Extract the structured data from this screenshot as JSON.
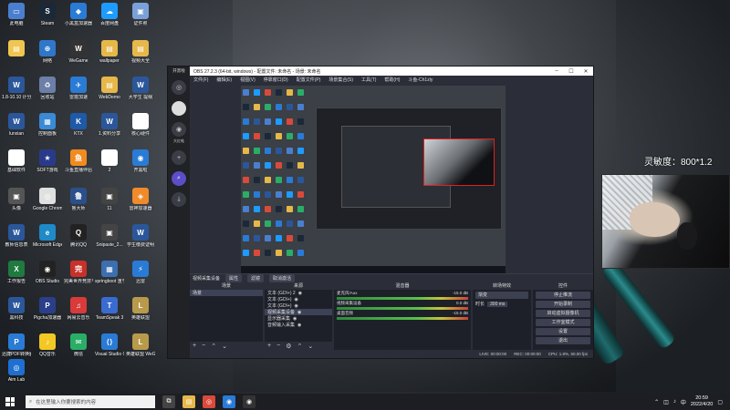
{
  "desktop": {
    "icons": [
      {
        "label": "此电脑",
        "color": "#4a7fd0",
        "glyph": "▭"
      },
      {
        "label": "Steam",
        "color": "#1b2838",
        "glyph": "S"
      },
      {
        "label": "小黑盒加速器",
        "color": "#2a7bd5",
        "glyph": "◆"
      },
      {
        "label": "百度网盘",
        "color": "#1e9bff",
        "glyph": "☁"
      },
      {
        "label": "证件照",
        "color": "#7aa0d8",
        "glyph": "▣"
      },
      {
        "label": "",
        "color": "#f0c650",
        "glyph": "▤"
      },
      {
        "label": "网络",
        "color": "#2f77c9",
        "glyph": "⊕"
      },
      {
        "label": "WeGame",
        "color": "#333333",
        "glyph": "W"
      },
      {
        "label": "wallpaper",
        "color": "#e6b84a",
        "glyph": "▤"
      },
      {
        "label": "视频大全",
        "color": "#e6b84a",
        "glyph": "▤"
      },
      {
        "label": "1.8-10.10 计分比例",
        "color": "#2b579a",
        "glyph": "W"
      },
      {
        "label": "回收站",
        "color": "#6b7fa8",
        "glyph": "♻"
      },
      {
        "label": "雷霆加速",
        "color": "#2a7bd5",
        "glyph": "✈"
      },
      {
        "label": "WebDemo",
        "color": "#e6b84a",
        "glyph": "▤"
      },
      {
        "label": "大学生 提纲",
        "color": "#2b579a",
        "glyph": "W"
      },
      {
        "label": "lunxian",
        "color": "#2b579a",
        "glyph": "W"
      },
      {
        "label": "控制面板",
        "color": "#3a8ad6",
        "glyph": "▦"
      },
      {
        "label": "KTX",
        "color": "#1e5aa8",
        "glyph": "K"
      },
      {
        "label": "1.资料分享",
        "color": "#2b579a",
        "glyph": "W"
      },
      {
        "label": "核心硬件",
        "color": "#ffffff",
        "glyph": "▭"
      },
      {
        "label": "基础软件",
        "color": "#ffffff",
        "glyph": "▭"
      },
      {
        "label": "SOFT游戏",
        "color": "#2a3a8a",
        "glyph": "★"
      },
      {
        "label": "斗鱼直播伴侣",
        "color": "#f28b1e",
        "glyph": "鱼"
      },
      {
        "label": "2",
        "color": "#ffffff",
        "glyph": "▭"
      },
      {
        "label": "开黑啦",
        "color": "#2a7bd5",
        "glyph": "◉"
      },
      {
        "label": "头像",
        "color": "#555555",
        "glyph": "▣"
      },
      {
        "label": "Google Chrome",
        "color": "#e0e0e0",
        "glyph": "◎"
      },
      {
        "label": "鲁大师",
        "color": "#2b4f8a",
        "glyph": "鲁"
      },
      {
        "label": "11",
        "color": "#444444",
        "glyph": "▣"
      },
      {
        "label": "雷神加速器",
        "color": "#f08a2a",
        "glyph": "◈"
      },
      {
        "label": "教师信息表",
        "color": "#2b579a",
        "glyph": "W"
      },
      {
        "label": "Microsoft Edge",
        "color": "#1e8ac8",
        "glyph": "e"
      },
      {
        "label": "腾讯QQ",
        "color": "#222222",
        "glyph": "Q"
      },
      {
        "label": "Snipaste_2...",
        "color": "#444444",
        "glyph": "▣"
      },
      {
        "label": "学生缴费证明",
        "color": "#2b579a",
        "glyph": "W"
      },
      {
        "label": "工作报告",
        "color": "#1f7a3f",
        "glyph": "X"
      },
      {
        "label": "OBS Studio",
        "color": "#222222",
        "glyph": "◉"
      },
      {
        "label": "完美世界竞技平台",
        "color": "#c8302a",
        "glyph": "完"
      },
      {
        "label": "springboot 重学",
        "color": "#3b6fb0",
        "glyph": "▦"
      },
      {
        "label": "迅雷",
        "color": "#2a7bd5",
        "glyph": "⚡"
      },
      {
        "label": "黑科技",
        "color": "#2b579a",
        "glyph": "W"
      },
      {
        "label": "Pigcha加速器",
        "color": "#2a3e8a",
        "glyph": "P"
      },
      {
        "label": "网易云音乐",
        "color": "#d93a3a",
        "glyph": "♫"
      },
      {
        "label": "TeamSpeak 3",
        "color": "#3a6bd0",
        "glyph": "T"
      },
      {
        "label": "英雄联盟",
        "color": "#b89a4a",
        "glyph": "L"
      },
      {
        "label": "迅捷PDF转换器",
        "color": "#2a7bd5",
        "glyph": "P"
      },
      {
        "label": "QQ音乐",
        "color": "#f2c824",
        "glyph": "♪"
      },
      {
        "label": "微信",
        "color": "#2aae67",
        "glyph": "✉"
      },
      {
        "label": "Visual Studio Code",
        "color": "#2a7bd5",
        "glyph": "⟨⟩"
      },
      {
        "label": "英雄联盟 WeGame版",
        "color": "#b89a4a",
        "glyph": "L"
      },
      {
        "label": "Aim Lab",
        "color": "#1e6fd0",
        "glyph": "◎"
      }
    ]
  },
  "obs": {
    "title": "OBS 27.2.3 (64-bit, windows) - 配置文件: 未命名 - 场景: 未命名",
    "menu": [
      "文件(F)",
      "编辑(E)",
      "视图(V)",
      "停靠窗口(D)",
      "配置文件(P)",
      "场景集合(S)",
      "工具(T)",
      "帮助(H)",
      "斗鱼-Ch1zly"
    ],
    "side_title": "开黑啦",
    "side_label": "大红蛙",
    "dock_bar": {
      "source_name": "视频采集设备",
      "props": "属性",
      "filter": "滤镜",
      "capture": "取消激活"
    },
    "scenes": {
      "header": "场景",
      "items": [
        "场景"
      ]
    },
    "sources": {
      "header": "来源",
      "items": [
        "文本 (GDI+) 2",
        "文本 (GDI+)",
        "文本 (GDI+)",
        "视频采集设备",
        "显示器采集",
        "音频输入采集"
      ]
    },
    "mixer": {
      "header": "混音器",
      "lines": [
        "麦克风/Aux",
        "视频采集设备",
        "桌面音频"
      ],
      "levels": [
        "-15.0 dB",
        "0.0 dB",
        "-15.0 dB"
      ]
    },
    "transitions": {
      "header": "转场特效",
      "type": "渐变",
      "duration_label": "时长",
      "duration": "300 ms"
    },
    "controls": {
      "header": "控件",
      "buttons": [
        "停止推流",
        "开始录制",
        "启动虚拟摄像机",
        "工作室模式",
        "设置",
        "退出"
      ]
    },
    "status": {
      "live": "LIVE: 00:00:00",
      "rec": "REC: 00:00:00",
      "cpu": "CPU: 1.8%, 60.00 fps"
    }
  },
  "overlay": {
    "sensitivity_text": "灵敏度：800*1.2"
  },
  "taskbar": {
    "search_placeholder": "在这里输入你要搜索的内容",
    "time": "20:59",
    "date": "2022/4/20",
    "pinned": [
      {
        "name": "task-view-icon",
        "color": "#444",
        "glyph": "⧉"
      },
      {
        "name": "file-explorer-icon",
        "color": "#e6b84a",
        "glyph": "▤"
      },
      {
        "name": "chrome-icon",
        "color": "#d94a3a",
        "glyph": "◎"
      },
      {
        "name": "kaiheila-icon",
        "color": "#2a7bd5",
        "glyph": "◉"
      },
      {
        "name": "obs-icon",
        "color": "#333",
        "glyph": "◉"
      }
    ]
  }
}
